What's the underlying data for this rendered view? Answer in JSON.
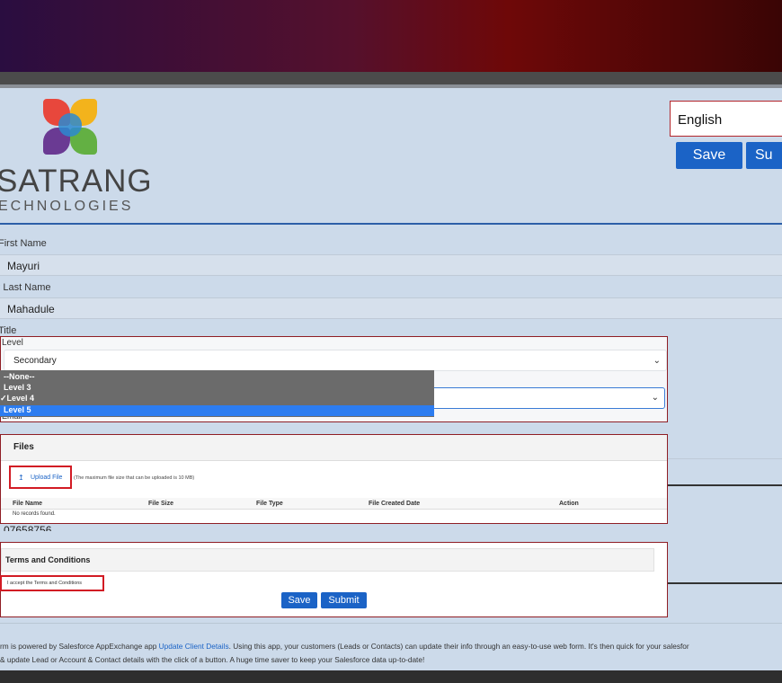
{
  "brand": {
    "name_line1": "SATRANG",
    "name_line2": "ECHNOLOGIES"
  },
  "language": {
    "selected": "English"
  },
  "top_buttons": {
    "save": "Save",
    "submit": "Su"
  },
  "fields": {
    "first_name_label": "First Name",
    "first_name_value": "Mayuri",
    "last_name_label": "* Last Name",
    "last_name_value": "Mahadule",
    "title_label": "Title",
    "level_label": "Level",
    "level_value": "Secondary",
    "email_label": "Email",
    "phone_value": "07658756"
  },
  "level_dropdown": {
    "options": [
      "--None--",
      "Level 3",
      "✓Level 4",
      "Level 5"
    ],
    "highlighted_index": 3
  },
  "files": {
    "title": "Files",
    "upload_label": "Upload File",
    "max_size_note": "(The maximum file size that can be uploaded is 10 MB)",
    "columns": [
      "File Name",
      "File Size",
      "File Type",
      "File Created Date",
      "Action"
    ],
    "empty_text": "No records found."
  },
  "terms": {
    "title": "Terms and Conditions",
    "accept_label": "I accept the Terms and Conditions",
    "save_label": "Save",
    "submit_label": "Submit"
  },
  "footer": {
    "line1_pre": "rm is powered by Salesforce AppExchange app ",
    "line1_link": "Update Client Details",
    "line1_post": ". Using this app, your customers (Leads or Contacts) can update their info through an easy-to-use web form. It's then quick for your salesfor",
    "line2": "& update Lead or Account & Contact details with the click of a button. A huge time saver to keep your Salesforce data up-to-date!"
  },
  "colors": {
    "accent": "#1b63c6",
    "error_border": "#d21b24",
    "page_bg": "#ccdaea"
  }
}
